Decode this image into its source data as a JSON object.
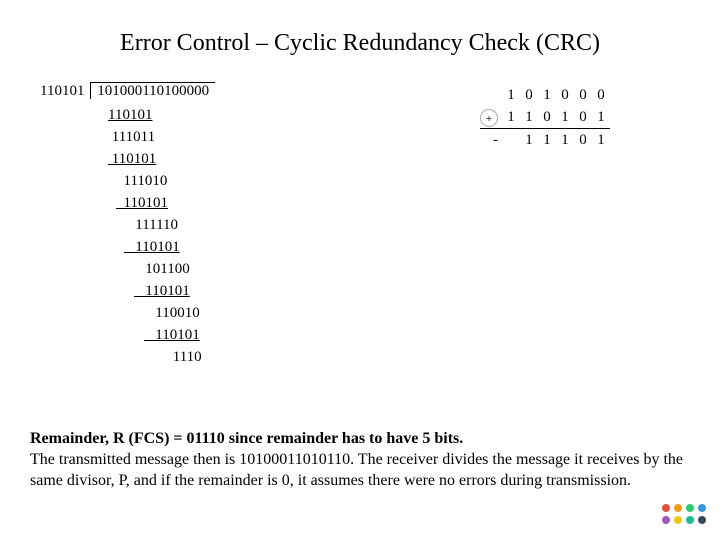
{
  "title": "Error Control – Cyclic Redundancy Check (CRC)",
  "division": {
    "divisor": "110101",
    "dividend": "101000110100000",
    "steps": [
      {
        "indent": 0,
        "text": "110101",
        "ul": true
      },
      {
        "indent": 0,
        "text": " 111011"
      },
      {
        "indent": 0,
        "text": " 110101",
        "ul": true
      },
      {
        "indent": 1,
        "text": "  111010"
      },
      {
        "indent": 1,
        "text": "  110101",
        "ul": true
      },
      {
        "indent": 2,
        "text": "   111110"
      },
      {
        "indent": 2,
        "text": "   110101",
        "ul": true
      },
      {
        "indent": 3,
        "text": "   101100"
      },
      {
        "indent": 3,
        "text": "   110101",
        "ul": true
      },
      {
        "indent": 4,
        "text": "   110010"
      },
      {
        "indent": 4,
        "text": "   110101",
        "ul": true
      },
      {
        "indent": 5,
        "text": "     1110"
      }
    ]
  },
  "plusblock": {
    "row1": [
      "1",
      "0",
      "1",
      "0",
      "0",
      "0"
    ],
    "op": "+",
    "row2": [
      "1",
      "1",
      "0",
      "1",
      "0",
      "1"
    ],
    "result_prefix": "-",
    "result": [
      "1",
      "1",
      "1",
      "0",
      "1"
    ]
  },
  "remark": {
    "line1_bold": "Remainder, R (FCS) = 01110 since remainder has to have 5 bits.",
    "line2": "The transmitted message then is 10100011010110. The receiver divides the message it receives by the same divisor, P, and if the remainder is 0, it assumes there were no errors during transmission."
  },
  "dots": {
    "colors_row1": [
      "#e74c3c",
      "#f39c12",
      "#2ecc71",
      "#3498db"
    ],
    "colors_row2": [
      "#9b59b6",
      "#f1c40f",
      "#1abc9c",
      "#34495e"
    ]
  }
}
